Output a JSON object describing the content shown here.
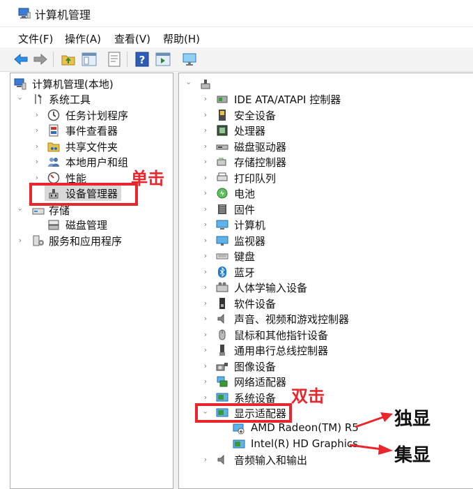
{
  "window": {
    "title": "计算机管理"
  },
  "menu": [
    "文件(F)",
    "操作(A)",
    "查看(V)",
    "帮助(H)"
  ],
  "left_tree": {
    "root": "计算机管理(本地)",
    "system_tools": "系统工具",
    "task_scheduler": "任务计划程序",
    "event_viewer": "事件查看器",
    "shared_folders": "共享文件夹",
    "local_users": "本地用户和组",
    "performance": "性能",
    "device_manager": "设备管理器",
    "storage": "存储",
    "disk_management": "磁盘管理",
    "services": "服务和应用程序"
  },
  "right_tree": {
    "categories": [
      "IDE ATA/ATAPI 控制器",
      "安全设备",
      "处理器",
      "磁盘驱动器",
      "存储控制器",
      "打印队列",
      "电池",
      "固件",
      "计算机",
      "监视器",
      "键盘",
      "蓝牙",
      "人体学输入设备",
      "软件设备",
      "声音、视频和游戏控制器",
      "鼠标和其他指针设备",
      "通用串行总线控制器",
      "图像设备",
      "网络适配器",
      "系统设备"
    ],
    "display_adapters": "显示适配器",
    "gpu_amd": "AMD Radeon(TM) R5",
    "gpu_intel": "Intel(R) HD Graphics",
    "audio_io": "音频输入和输出"
  },
  "annotations": {
    "single_click": "单击",
    "double_click": "双击",
    "discrete": "独显",
    "integrated": "集显"
  },
  "colors": {
    "annotation_red": "#e8262b",
    "selection": "#d9d9d9",
    "accent_blue": "#1e7bd8"
  }
}
